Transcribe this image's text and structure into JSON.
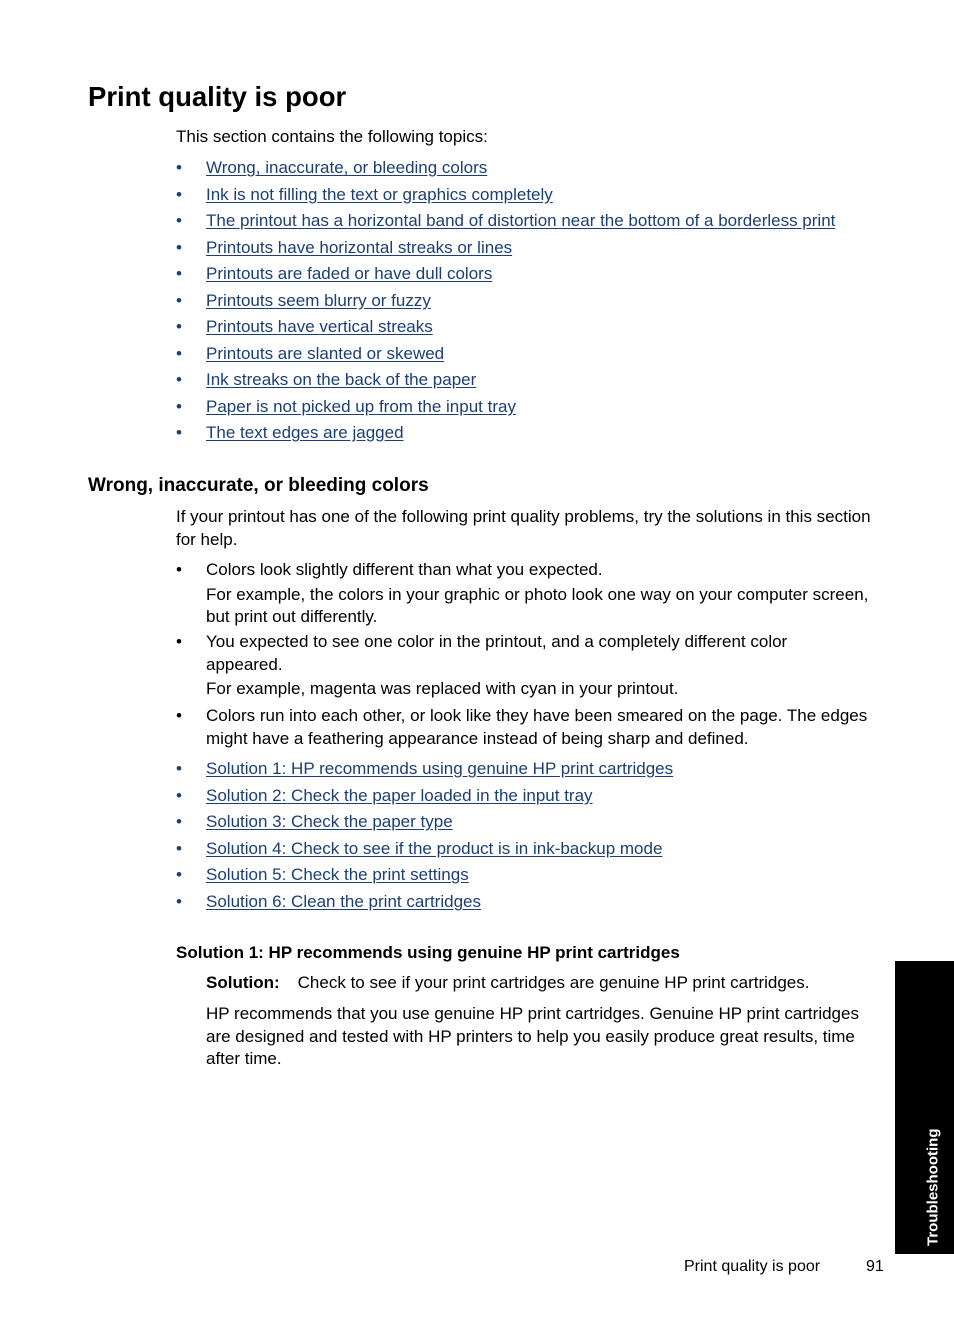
{
  "page": {
    "title": "Print quality is poor",
    "intro": "This section contains the following topics:",
    "topics": [
      "Wrong, inaccurate, or bleeding colors",
      "Ink is not filling the text or graphics completely",
      "The printout has a horizontal band of distortion near the bottom of a borderless print",
      "Printouts have horizontal streaks or lines",
      "Printouts are faded or have dull colors",
      "Printouts seem blurry or fuzzy",
      "Printouts have vertical streaks",
      "Printouts are slanted or skewed",
      "Ink streaks on the back of the paper",
      "Paper is not picked up from the input tray",
      "The text edges are jagged"
    ],
    "section": {
      "heading": "Wrong, inaccurate, or bleeding colors",
      "intro": "If your printout has one of the following print quality problems, try the solutions in this section for help.",
      "problems": [
        {
          "main": "Colors look slightly different than what you expected.",
          "detail": "For example, the colors in your graphic or photo look one way on your computer screen, but print out differently."
        },
        {
          "main": "You expected to see one color in the printout, and a completely different color appeared.",
          "detail": "For example, magenta was replaced with cyan in your printout."
        },
        {
          "main": "Colors run into each other, or look like they have been smeared on the page. The edges might have a feathering appearance instead of being sharp and defined.",
          "detail": ""
        }
      ],
      "solutions": [
        "Solution 1: HP recommends using genuine HP print cartridges",
        "Solution 2: Check the paper loaded in the input tray",
        "Solution 3: Check the paper type",
        "Solution 4: Check to see if the product is in ink-backup mode",
        "Solution 5: Check the print settings",
        "Solution 6: Clean the print cartridges"
      ]
    },
    "solution1": {
      "heading": "Solution 1: HP recommends using genuine HP print cartridges",
      "label": "Solution:",
      "text": "Check to see if your print cartridges are genuine HP print cartridges.",
      "body": "HP recommends that you use genuine HP print cartridges. Genuine HP print cartridges are designed and tested with HP printers to help you easily produce great results, time after time."
    },
    "bullet": "•",
    "side_tab": "Troubleshooting",
    "footer": {
      "title": "Print quality is poor",
      "page_number": "91"
    },
    "colors": {
      "link": "#1c3f73",
      "tab": "#000000"
    }
  }
}
